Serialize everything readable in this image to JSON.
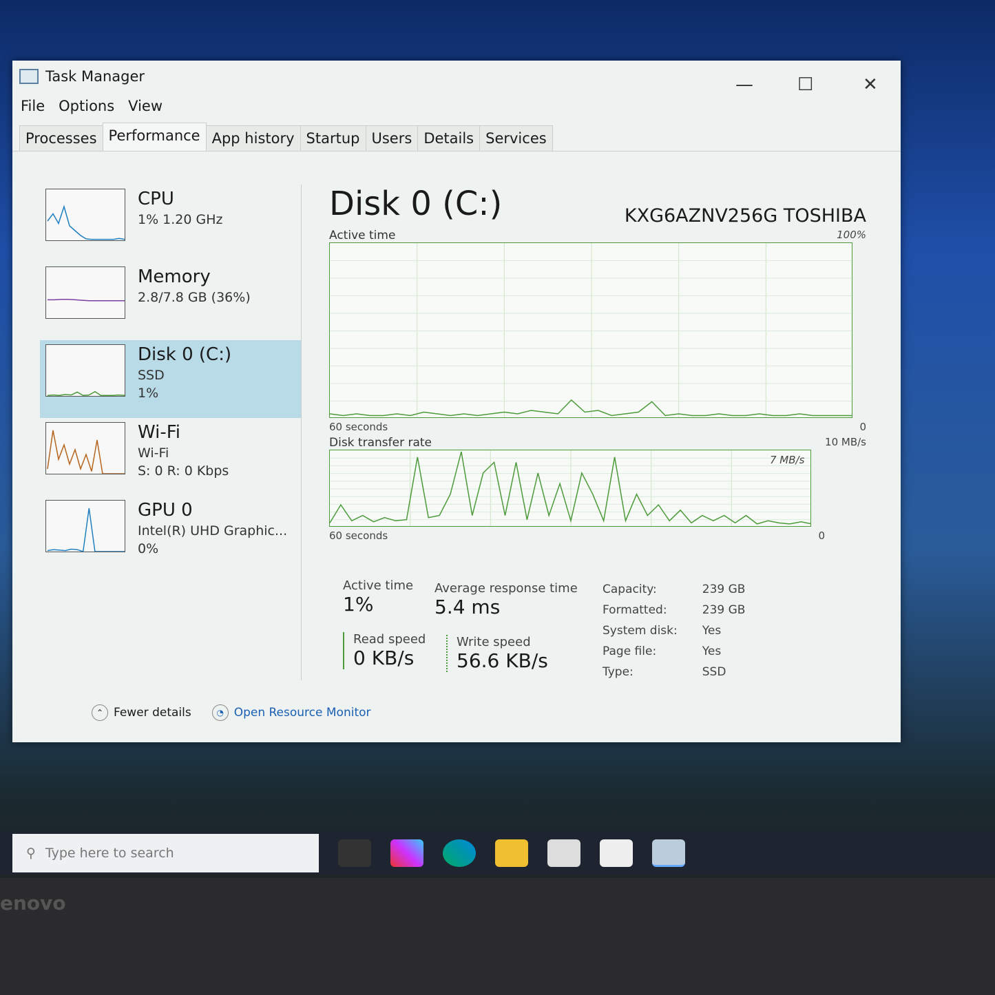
{
  "window": {
    "title": "Task Manager",
    "minimize": "—",
    "maximize": "☐",
    "close": "✕"
  },
  "menu": [
    "File",
    "Options",
    "View"
  ],
  "tabs": [
    "Processes",
    "Performance",
    "App history",
    "Startup",
    "Users",
    "Details",
    "Services"
  ],
  "active_tab": "Performance",
  "sidebar": [
    {
      "name": "CPU",
      "sub1": "1% 1.20 GHz",
      "sub2": "",
      "color": "#1f7fc0",
      "history": [
        40,
        55,
        35,
        70,
        30,
        20,
        10,
        3,
        2,
        2,
        2,
        2,
        2,
        4,
        2
      ]
    },
    {
      "name": "Memory",
      "sub1": "2.8/7.8 GB (36%)",
      "sub2": "",
      "color": "#7b3fa0",
      "history": [
        38,
        38,
        39,
        39,
        38,
        37,
        36,
        36,
        36,
        36,
        36,
        36
      ]
    },
    {
      "name": "Disk 0 (C:)",
      "sub1": "SSD",
      "sub2": "1%",
      "color": "#4c9a3a",
      "history": [
        1,
        2,
        1,
        3,
        2,
        8,
        1,
        2,
        9,
        1,
        1,
        1,
        2,
        1
      ]
    },
    {
      "name": "Wi-Fi",
      "sub1": "Wi-Fi",
      "sub2": "S: 0 R: 0 Kbps",
      "color": "#b5651d",
      "history": [
        10,
        90,
        30,
        60,
        20,
        50,
        10,
        40,
        5,
        70,
        0,
        0,
        0,
        0,
        0
      ]
    },
    {
      "name": "GPU 0",
      "sub1": "Intel(R) UHD Graphic...",
      "sub2": "0%",
      "color": "#1f7fc0",
      "history": [
        2,
        4,
        3,
        2,
        5,
        4,
        0,
        90,
        0,
        0,
        0,
        0,
        0,
        0
      ]
    }
  ],
  "main": {
    "title": "Disk 0 (C:)",
    "model": "KXG6AZNV256G TOSHIBA",
    "active_chart": {
      "label": "Active time",
      "max": "100%",
      "min": "0",
      "span": "60 seconds",
      "color": "#4c9a3a",
      "values": [
        2,
        1,
        2,
        1,
        1,
        2,
        1,
        3,
        2,
        1,
        2,
        1,
        2,
        3,
        2,
        4,
        3,
        2,
        10,
        3,
        4,
        1,
        2,
        3,
        9,
        1,
        2,
        1,
        1,
        2,
        1,
        1,
        2,
        1,
        1,
        2,
        1,
        1,
        1,
        1
      ]
    },
    "transfer_chart": {
      "label": "Disk transfer rate",
      "max": "10 MB/s",
      "inner_max": "7 MB/s",
      "min": "0",
      "span": "60 seconds",
      "color": "#4c9a3a",
      "values": [
        0.3,
        2,
        0.5,
        1,
        0.4,
        0.8,
        0.5,
        0.6,
        6.5,
        0.8,
        1,
        3,
        7,
        1,
        5,
        6,
        1,
        6,
        0.6,
        5,
        1,
        4,
        0.5,
        5,
        3,
        0.5,
        6.5,
        0.5,
        3,
        1,
        2,
        0.5,
        1.5,
        0.3,
        1,
        0.5,
        1,
        0.3,
        1,
        0.2,
        0.5,
        0.3,
        0.2,
        0.4,
        0.2
      ]
    },
    "stats": {
      "active_time_label": "Active time",
      "active_time": "1%",
      "avg_resp_label": "Average response time",
      "avg_resp": "5.4 ms",
      "read_label": "Read speed",
      "read": "0 KB/s",
      "write_label": "Write speed",
      "write": "56.6 KB/s"
    },
    "properties": [
      [
        "Capacity:",
        "239 GB"
      ],
      [
        "Formatted:",
        "239 GB"
      ],
      [
        "System disk:",
        "Yes"
      ],
      [
        "Page file:",
        "Yes"
      ],
      [
        "Type:",
        "SSD"
      ]
    ]
  },
  "footer": {
    "fewer": "Fewer details",
    "resmon": "Open Resource Monitor"
  },
  "taskbar": {
    "search_placeholder": "Type here to search",
    "icons": [
      "task-view",
      "copilot",
      "edge",
      "file-explorer",
      "store",
      "mail",
      "task-manager"
    ]
  },
  "laptop_brand": "lenovo"
}
